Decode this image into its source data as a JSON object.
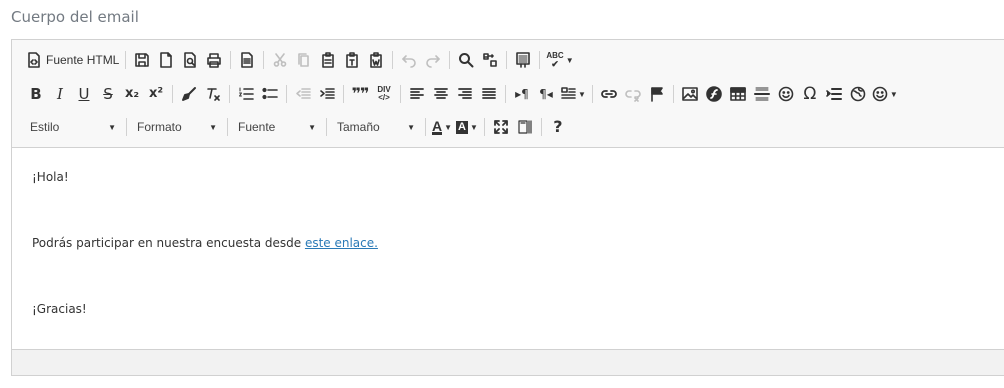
{
  "field": {
    "label": "Cuerpo del email"
  },
  "toolbar": {
    "source_label": "Fuente HTML",
    "combos": {
      "style": "Estilo",
      "format": "Formato",
      "font": "Fuente",
      "size": "Tamaño"
    },
    "icons": {
      "bold": "B",
      "italic": "I",
      "underline": "U",
      "strike": "S",
      "subscript": "x₂",
      "superscript": "x²",
      "blockquote": "99",
      "omega": "Ω",
      "help": "?",
      "text_color": "A",
      "bg_color": "A",
      "spellcheck": "ABC",
      "div": "DIV"
    }
  },
  "content": {
    "greeting": "¡Hola!",
    "body_text": "Podrás participar en nuestra encuesta desde ",
    "link_text": "este enlace.",
    "closing": "¡Gracias!"
  },
  "colors": {
    "link": "#2a7ab7",
    "toolbar_bg": "#f8f8f8",
    "label": "#737a82"
  }
}
